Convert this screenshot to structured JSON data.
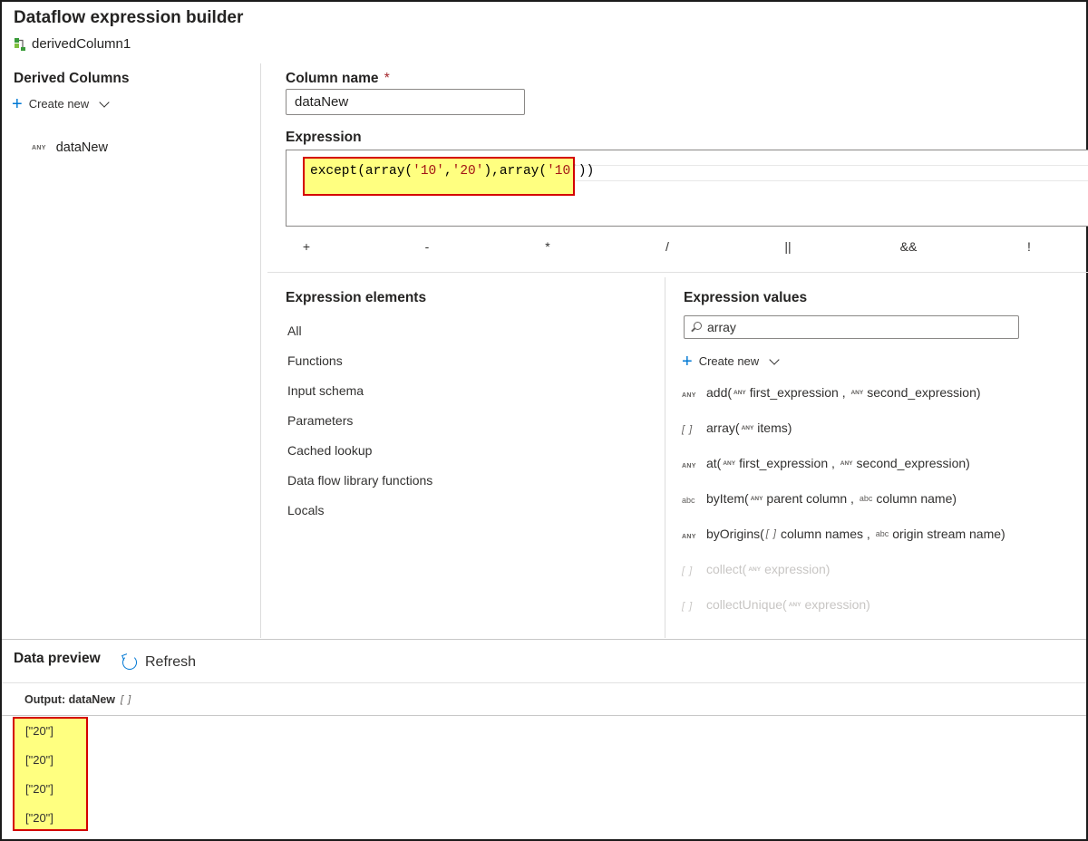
{
  "header": {
    "title": "Dataflow expression builder",
    "subtitle": "derivedColumn1"
  },
  "left_panel": {
    "heading": "Derived Columns",
    "create_new": "Create new",
    "items": [
      {
        "type_tag": "ANY",
        "label": "dataNew"
      }
    ]
  },
  "column_name": {
    "label": "Column name",
    "required_mark": "*",
    "value": "dataNew"
  },
  "expression": {
    "label": "Expression",
    "text_parts": [
      "except(array(",
      "'10'",
      ",",
      "'20'",
      "),array(",
      "'10'",
      "))"
    ]
  },
  "operators": [
    "+",
    "-",
    "*",
    "/",
    "||",
    "&&",
    "!"
  ],
  "expression_elements": {
    "heading": "Expression elements",
    "items": [
      "All",
      "Functions",
      "Input schema",
      "Parameters",
      "Cached lookup",
      "Data flow library functions",
      "Locals"
    ]
  },
  "expression_values": {
    "heading": "Expression values",
    "search_value": "array",
    "create_new": "Create new",
    "type_tags": {
      "any": "ANY",
      "array": "[ ]",
      "abc": "abc"
    },
    "functions": [
      {
        "name": "add(",
        "args": [
          [
            "ANY",
            "first_expression"
          ],
          [
            "ANY",
            "second_expression"
          ]
        ]
      },
      {
        "name": "array(",
        "args": [
          [
            "ANY",
            "items"
          ]
        ]
      },
      {
        "name": "at(",
        "args": [
          [
            "ANY",
            "first_expression"
          ],
          [
            "ANY",
            "second_expression"
          ]
        ]
      },
      {
        "name": "byItem(",
        "args": [
          [
            "ANY",
            "parent column"
          ],
          [
            "abc",
            "column name"
          ]
        ]
      },
      {
        "name": "byOrigins(",
        "args": [
          [
            "[ ]",
            "column names"
          ],
          [
            "abc",
            "origin stream name"
          ]
        ]
      },
      {
        "name": "collect(",
        "args": [
          [
            "ANY",
            "expression"
          ]
        ]
      },
      {
        "name": "collectUnique(",
        "args": [
          [
            "ANY",
            "expression"
          ]
        ]
      }
    ]
  },
  "data_preview": {
    "heading": "Data preview",
    "refresh_label": "Refresh",
    "output_label": "Output: dataNew",
    "output_type": "[ ]",
    "rows": [
      "[\"20\"]",
      "[\"20\"]",
      "[\"20\"]",
      "[\"20\"]"
    ]
  },
  "colors": {
    "accent": "#0078d4",
    "highlight_fill": "#ffff80",
    "highlight_border": "#d40000",
    "string_literal": "#a31515"
  }
}
